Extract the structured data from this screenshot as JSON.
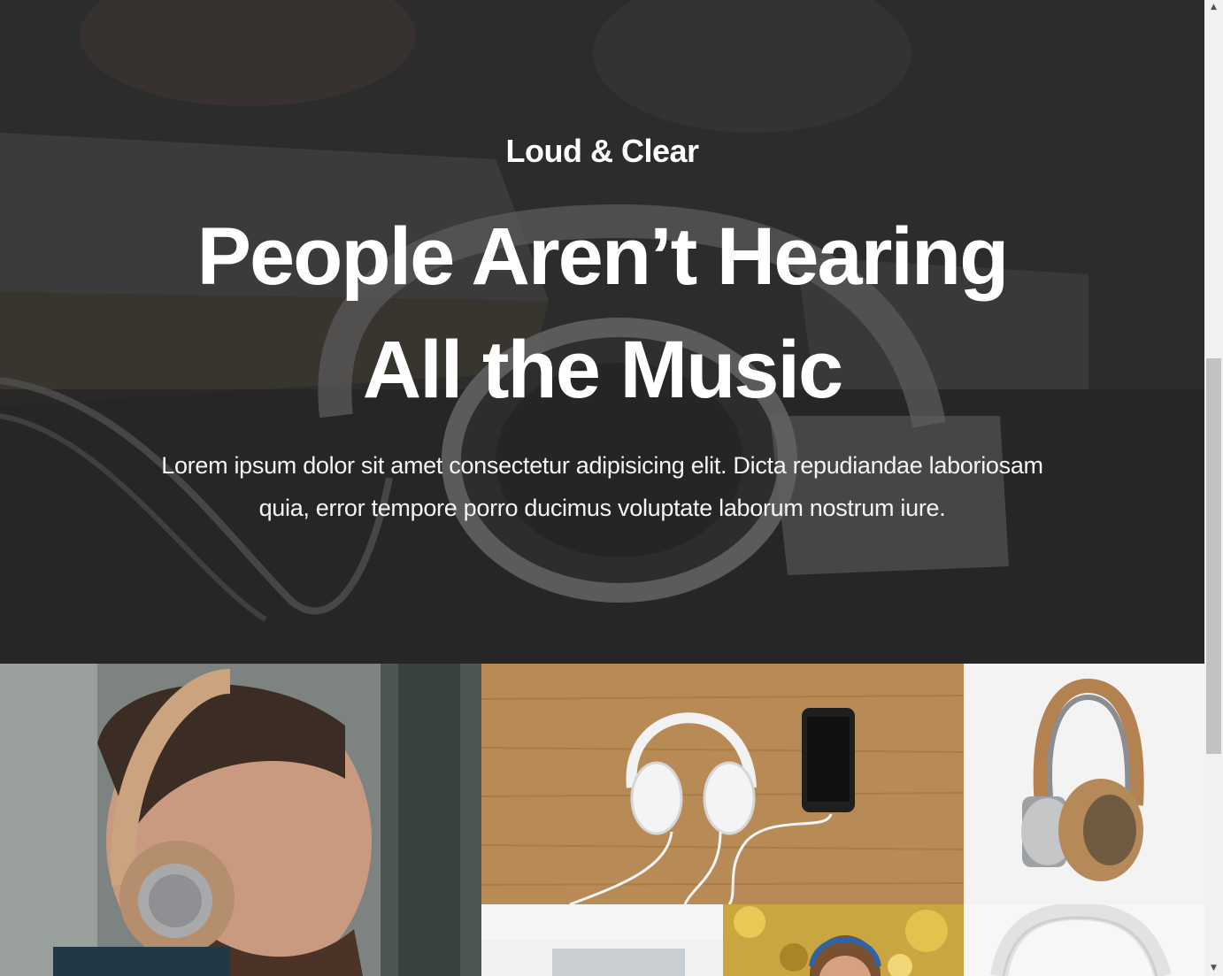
{
  "hero": {
    "kicker": "Loud & Clear",
    "title_line1": "People Aren’t Hearing",
    "title_line2": "All the Music",
    "text_line1": "Lorem ipsum dolor sit amet consectetur adipisicing elit. Dicta repudiandae laboriosam",
    "text_line2": "quia, error tempore porro ducimus voluptate laborum nostrum iure.",
    "background_icon": "headphones-on-desk-photo"
  },
  "gallery": {
    "images": [
      {
        "icon": "man-wearing-headphones-photo"
      },
      {
        "icon": "white-headphones-and-phone-on-wood-photo"
      },
      {
        "icon": "tan-headphones-product-photo"
      },
      {
        "icon": "blurred-product-photo"
      },
      {
        "icon": "child-with-headphones-photo"
      },
      {
        "icon": "white-headphones-product-photo"
      }
    ]
  },
  "scrollbar": {
    "up_arrow": "▲",
    "down_arrow": "▼"
  },
  "colors": {
    "hero_text": "#ffffff",
    "scroll_thumb": "#c1c1c1",
    "scroll_track": "#f1f1f1"
  }
}
